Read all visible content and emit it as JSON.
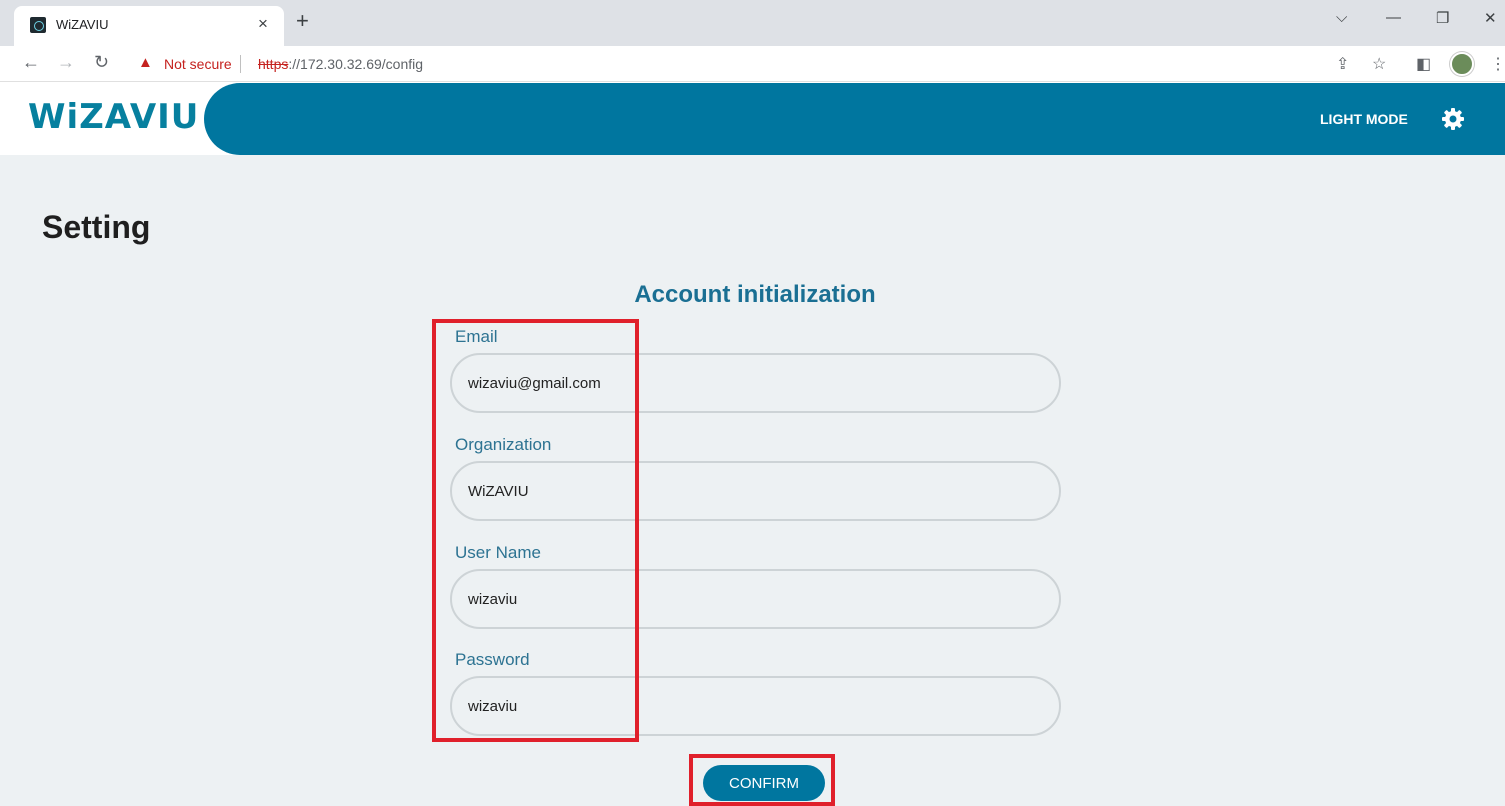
{
  "browser": {
    "tab_title": "WiZAVIU",
    "tab_close": "×",
    "new_tab": "+",
    "not_secure": "Not secure",
    "url_proto": "https",
    "url_rest": "://172.30.32.69/config",
    "window_controls": {
      "dropdown": "⌵",
      "minimize": "—",
      "restore": "❐",
      "close": "✕"
    }
  },
  "header": {
    "logo": "WiZAVIU",
    "light_mode_label": "LIGHT MODE",
    "icon": "gear-icon",
    "bar_color": "#00769f"
  },
  "page": {
    "title": "Setting",
    "section_title": "Account initialization"
  },
  "form": {
    "email": {
      "label": "Email",
      "value": "wizaviu@gmail.com"
    },
    "organization": {
      "label": "Organization",
      "value": "WiZAVIU"
    },
    "username": {
      "label": "User Name",
      "value": "wizaviu"
    },
    "password": {
      "label": "Password",
      "value": "wizaviu"
    },
    "confirm_label": "CONFIRM"
  },
  "colors": {
    "accent": "#00769f",
    "highlight": "#e0202b",
    "background": "#edf1f3"
  }
}
